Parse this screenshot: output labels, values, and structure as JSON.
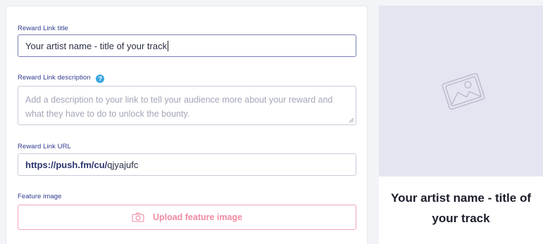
{
  "form": {
    "title_field": {
      "label": "Reward Link title",
      "value": "Your artist name - title of your track"
    },
    "description_field": {
      "label": "Reward Link description",
      "help_icon": "question-circle-icon",
      "placeholder": "Add a description to your link to tell your audience more about your reward and what they have to do to unlock the bounty."
    },
    "url_field": {
      "label": "Reward Link URL",
      "prefix": "https://push.fm/cu/",
      "slug": "qjyajufc"
    },
    "feature_image": {
      "label": "Feature image",
      "upload_label": "Upload feature image",
      "upload_icon": "camera-icon"
    }
  },
  "preview": {
    "image_icon": "image-placeholder-icon",
    "title": "Your artist name - title of your track"
  },
  "colors": {
    "label": "#2f3a8c",
    "upload_accent": "#ef8aa0",
    "help_icon": "#3aa6e0",
    "preview_bg": "#e4e5f0"
  }
}
